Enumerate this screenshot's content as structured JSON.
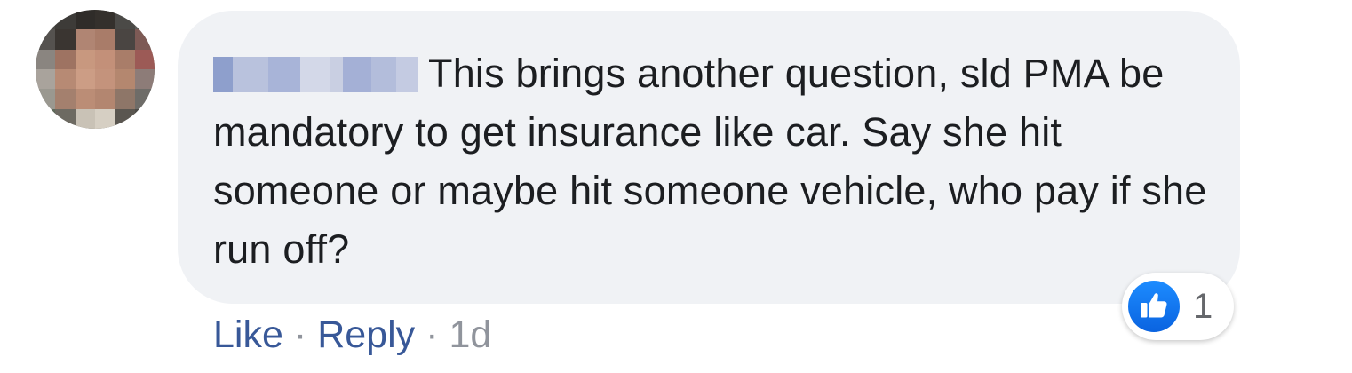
{
  "comment": {
    "author_redacted": true,
    "text": "This brings another question, sld PMA be mandatory to get insurance like car. Say she hit someone or maybe hit someone vehicle, who pay if she run off?",
    "reaction": {
      "icon": "like-icon",
      "count": "1",
      "color": "#1877f2"
    }
  },
  "actions": {
    "like_label": "Like",
    "separator": "·",
    "reply_label": "Reply",
    "timestamp": "1d"
  },
  "colors": {
    "bubble_bg": "#f0f2f5",
    "link": "#385898",
    "text": "#1c1e21",
    "meta": "#90949c"
  }
}
